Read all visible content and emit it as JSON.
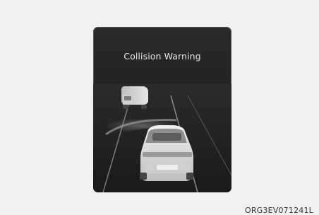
{
  "warning": {
    "title": "Collision Warning"
  },
  "image_code": "ORG3EV071241L",
  "icons": {
    "vehicle_ahead": "truck-icon",
    "ego_vehicle": "car-rear-icon",
    "collision_path": "warning-arc-icon"
  },
  "colors": {
    "page_background": "#f1f1f1",
    "panel_background": "#232323",
    "title_text": "#e6e6e6",
    "vehicle_fill": "#d9d9d9"
  }
}
